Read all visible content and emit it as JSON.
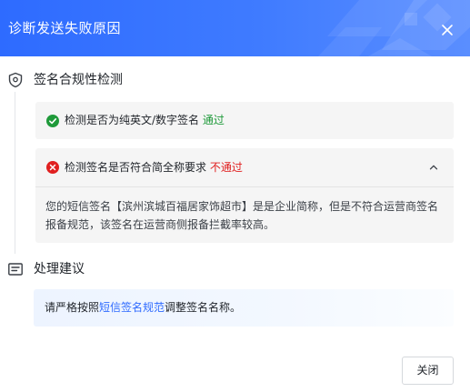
{
  "dialog": {
    "title": "诊断发送失败原因",
    "close_button_label": "关闭"
  },
  "signature_check": {
    "section_title": "签名合规性检测",
    "item1": {
      "label": "检测是否为纯英文/数字签名",
      "status": "通过"
    },
    "item2": {
      "label": "检测签名是否符合简全称要求",
      "status": "不通过",
      "detail": "您的短信签名【滨州滨城百福居家饰超市】是是企业简称，但是不符合运营商签名报备规范，该签名在运营商侧报备拦截率较高。"
    }
  },
  "suggestion": {
    "section_title": "处理建议",
    "text_before": "请严格按照",
    "link_text": "短信签名规范",
    "text_after": "调整签名名称。"
  },
  "colors": {
    "header_blue": "#2e6bff",
    "pass_green": "#1f9a3a",
    "fail_red": "#e02020",
    "link_blue": "#2f6bff"
  }
}
